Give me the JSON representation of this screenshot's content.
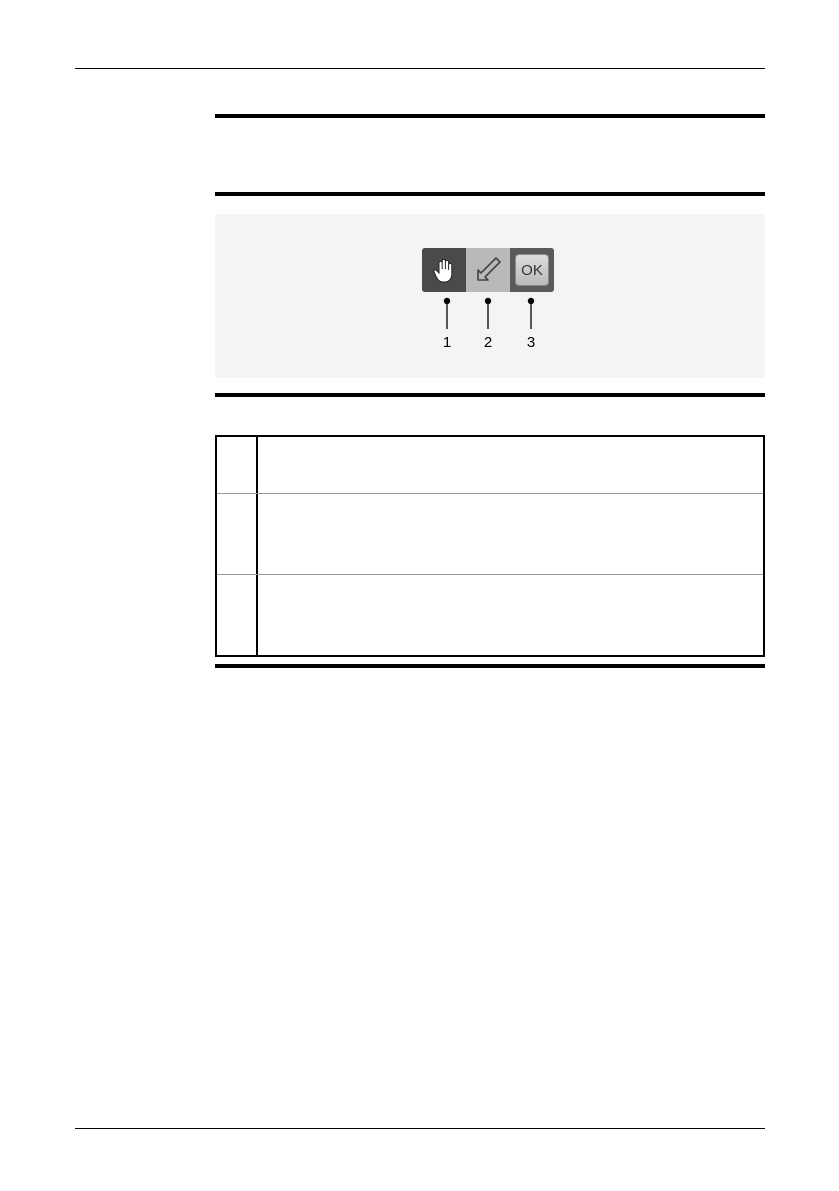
{
  "figure": {
    "toolbar": {
      "buttons": [
        {
          "icon": "hand-icon"
        },
        {
          "icon": "arrow-icon"
        },
        {
          "icon": "ok-icon",
          "label": "OK"
        }
      ]
    },
    "callouts": [
      "1",
      "2",
      "3"
    ]
  },
  "legend_rows": [
    {
      "num": "",
      "text": ""
    },
    {
      "num": "",
      "text": ""
    },
    {
      "num": "",
      "text": ""
    }
  ],
  "colors": {
    "toolbar_dark": "#4a4a4a",
    "toolbar_light": "#b9b9b9",
    "figure_bg": "#f4f4f4"
  }
}
